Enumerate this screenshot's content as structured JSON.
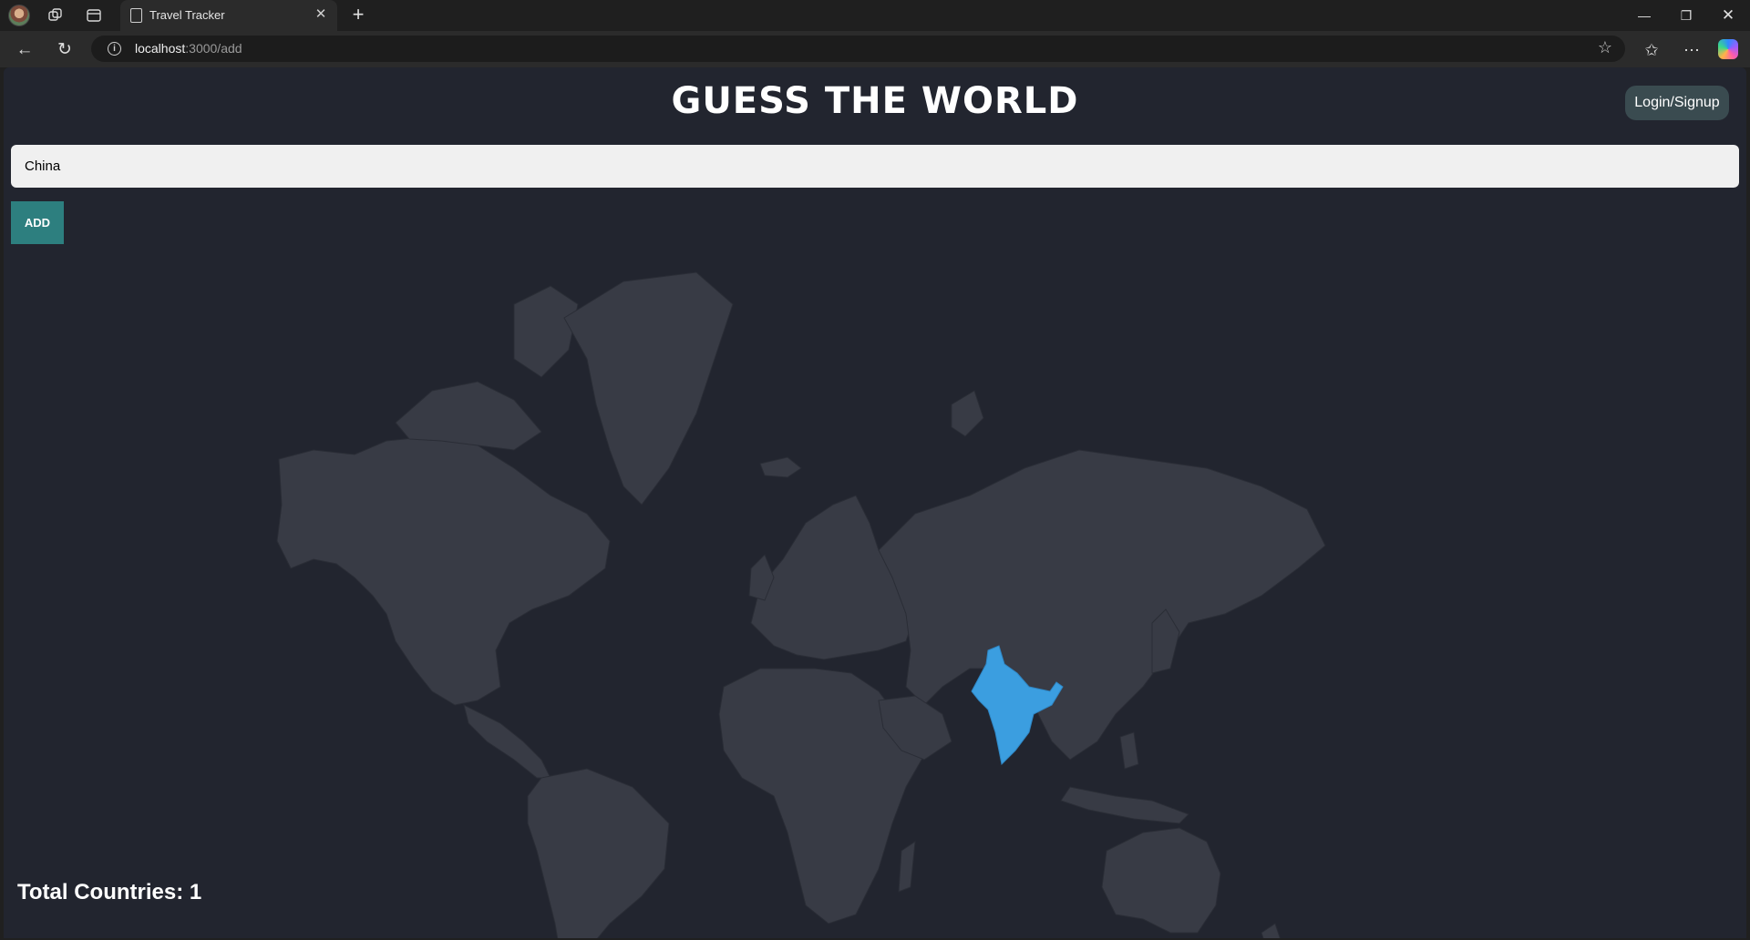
{
  "browser": {
    "tab_title": "Travel Tracker",
    "url_host": "localhost",
    "url_path": ":3000/add"
  },
  "page": {
    "title": "GUESS THE WORLD",
    "login_label": "Login/Signup",
    "input_value": "China",
    "add_label": "ADD",
    "total_label": "Total Countries:",
    "total_count": "1"
  },
  "map": {
    "visited_countries": [
      "India"
    ],
    "land_color": "#383b45",
    "visited_color": "#3b9ee0",
    "background_color": "#22252f"
  }
}
